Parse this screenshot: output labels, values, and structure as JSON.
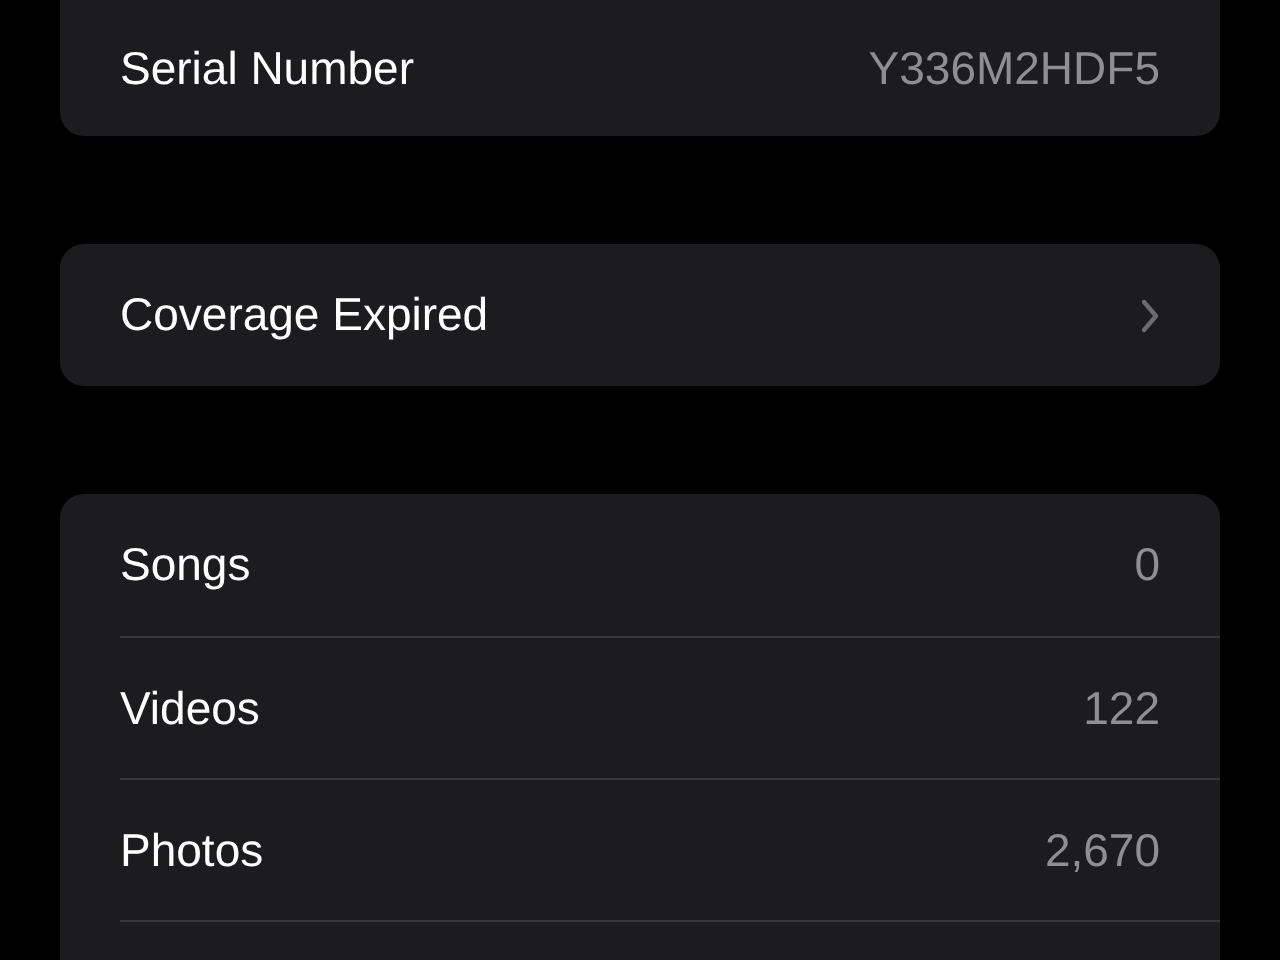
{
  "groups": [
    {
      "rows": [
        {
          "kind": "value",
          "label": "Serial Number",
          "value": "Y336M2HDF5"
        }
      ]
    },
    {
      "rows": [
        {
          "kind": "link",
          "label": "Coverage Expired"
        }
      ]
    },
    {
      "rows": [
        {
          "kind": "value",
          "label": "Songs",
          "value": "0"
        },
        {
          "kind": "value",
          "label": "Videos",
          "value": "122"
        },
        {
          "kind": "value",
          "label": "Photos",
          "value": "2,670"
        }
      ]
    }
  ]
}
